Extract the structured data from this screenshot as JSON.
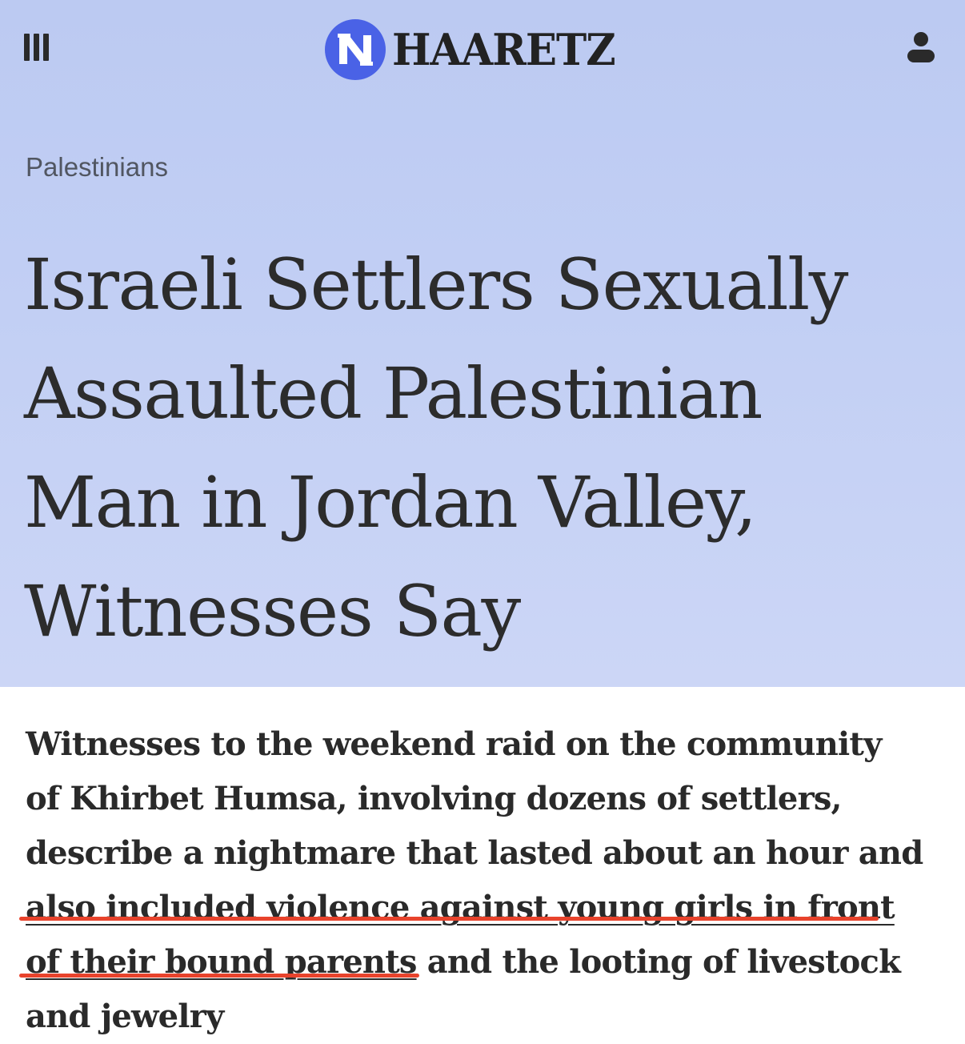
{
  "header": {
    "menu_icon": "hamburger-menu-icon",
    "logo_icon": "haaretz-logo-icon",
    "logo_text": "HAARETZ",
    "account_icon": "user-icon",
    "brand_color": "#4a62e6"
  },
  "article": {
    "category": "Palestinians",
    "headline_lines": [
      "Israeli Settlers Sexually",
      "Assaulted Palestinian",
      "Man in Jordan Valley,",
      "Witnesses Say"
    ],
    "lead": {
      "line1": "Witnesses to the weekend raid on the community",
      "line2": "of Khirbet Humsa, involving dozens of settlers,",
      "line3": "describe a nightmare that lasted about an hour and",
      "line4_marked": "also included violence against young girls in front",
      "line5_marked": "of their bound parents",
      "line5_rest": " and the looting of livestock",
      "line6": "and jewelry"
    },
    "highlight_color": "#e8432c",
    "hero_color": "#c2cff4"
  }
}
